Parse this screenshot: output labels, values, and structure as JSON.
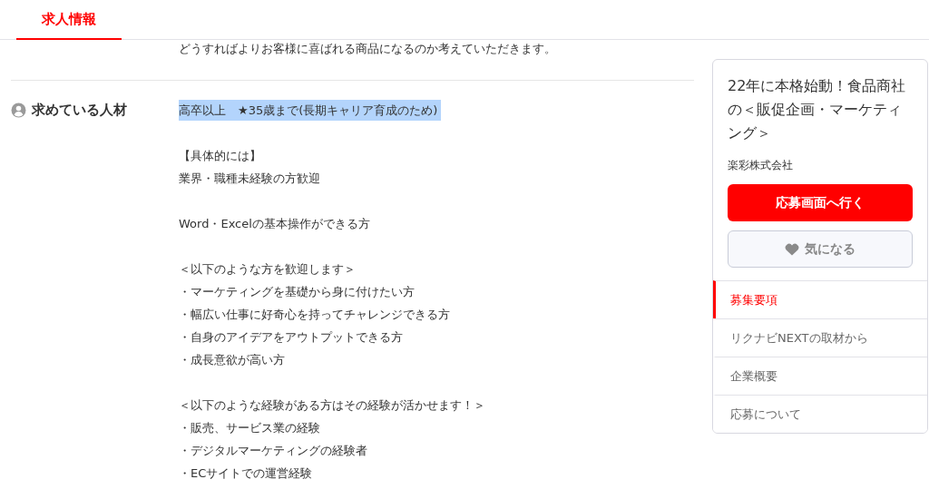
{
  "tabs": [
    {
      "label": "求人情報",
      "selected": true
    }
  ],
  "intro_text": "どうすればよりお客様に喜ばれる商品になるのか考えていただきます。",
  "section": {
    "heading": "求めている人材",
    "paragraphs": [
      [
        {
          "text": "高卒以上　★35歳まで(長期キャリア育成のため)",
          "highlighted": true
        }
      ],
      [
        {
          "text": "【具体的には】",
          "highlighted": false
        },
        {
          "text": "業界・職種未経験の方歓迎",
          "highlighted": false
        }
      ],
      [
        {
          "text": "Word・Excelの基本操作ができる方",
          "highlighted": false
        }
      ],
      [
        {
          "text": "＜以下のような方を歓迎します＞",
          "highlighted": false
        },
        {
          "text": "・マーケティングを基礎から身に付けたい方",
          "highlighted": false
        },
        {
          "text": "・幅広い仕事に好奇心を持ってチャレンジできる方",
          "highlighted": false
        },
        {
          "text": "・自身のアイデアをアウトプットできる方",
          "highlighted": false
        },
        {
          "text": "・成長意欲が高い方",
          "highlighted": false
        }
      ],
      [
        {
          "text": "＜以下のような経験がある方はその経験が活かせます！＞",
          "highlighted": false
        },
        {
          "text": "・販売、サービス業の経験",
          "highlighted": false
        },
        {
          "text": "・デジタルマーケティングの経験者",
          "highlighted": false
        },
        {
          "text": "・ECサイトでの運営経験",
          "highlighted": false
        }
      ]
    ]
  },
  "sidebar": {
    "job_title": "22年に本格始動！食品商社の＜販促企画・マーケティング＞",
    "company": "楽彩株式会社",
    "apply_button": "応募画面へ行く",
    "favorite_button": "気になる",
    "nav": [
      {
        "label": "募集要項",
        "selected": true
      },
      {
        "label": "リクナビNEXTの取材から",
        "selected": false
      },
      {
        "label": "企業概要",
        "selected": false
      },
      {
        "label": "応募について",
        "selected": false
      }
    ]
  }
}
